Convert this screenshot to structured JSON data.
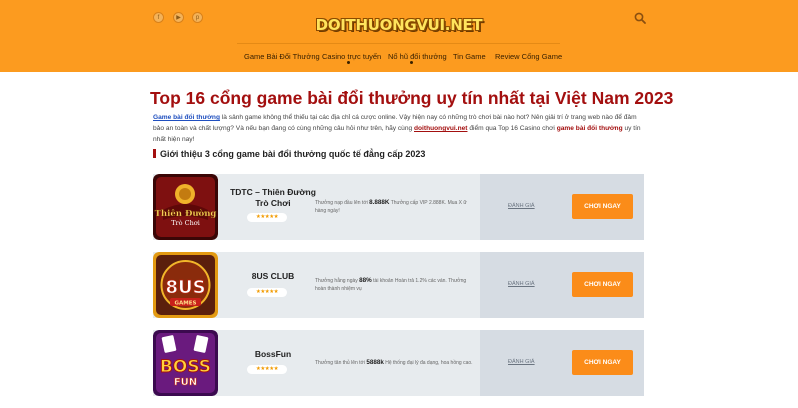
{
  "header": {
    "logo_text": "DOITHUONGVUI.NET",
    "social_icons": [
      "facebook-icon",
      "youtube-icon",
      "pinterest-icon"
    ],
    "nav": [
      {
        "label": "Game Bài Đổi Thưởng"
      },
      {
        "label": "Casino trực tuyến"
      },
      {
        "label": "Nổ hũ đổi thưởng"
      },
      {
        "label": "Tin Game"
      },
      {
        "label": "Review Cổng Game"
      }
    ],
    "colors": {
      "background": "#fc9b1f",
      "logo": "#ffe45c"
    }
  },
  "main": {
    "title": "Top 16 cổng game bài đổi thưởng uy tín nhất tại Việt Nam 2023",
    "intro": {
      "link1": "Game bài đổi thưởng",
      "text1": " là sảnh game không thể thiếu tại các địa chỉ cá cược online. Vậy hiện nay có những trò chơi bài nào hot? Nên giải trí ở trang web nào để đảm bảo an toàn và chất lượng? Và nếu bạn đang có cùng những câu hỏi như trên, hãy cùng ",
      "link2": "doithuongvui.net",
      "text2": " điểm qua Top 16 Casino chơi ",
      "bold": "game bài đổi thưởng",
      "text3": " uy tín nhất hiện nay!"
    },
    "section_heading": "Giới thiệu 3 cổng game bài đổi thưởng quốc tế đẳng cấp 2023",
    "cards": [
      {
        "logo_line1": "Thiên Đường",
        "logo_line2": "Trò Chơi",
        "name": "TDTC – Thiên Đường Trò Chơi",
        "stars": "★★★★★",
        "desc_pre": "Thưởng nạp đầu lên tới ",
        "desc_bold": "8.888K",
        "desc_post": " Thưởng cấp VIP 2.888K. Mua X ữ hàng ngày!",
        "review": "ĐÁNH GIÁ",
        "cta": "CHƠI NGAY"
      },
      {
        "logo_line1": "8US",
        "logo_line2": "GAMES",
        "name": "8US CLUB",
        "stars": "★★★★★",
        "desc_pre": "Thưởng hằng ngày ",
        "desc_bold": "88%",
        "desc_post": " tài khoản Hoàn trả 1.2% các ván. Thưởng hoàn thành nhiệm vụ",
        "review": "ĐÁNH GIÁ",
        "cta": "CHƠI NGAY"
      },
      {
        "logo_line1": "BOSS",
        "logo_line2": "FUN",
        "name": "BossFun",
        "stars": "★★★★★",
        "desc_pre": "Thưởng tân thủ lên tới ",
        "desc_bold": "5888k",
        "desc_post": " Hệ thống đại lý đa dạng, hoa hồng cao.",
        "review": "ĐÁNH GIÁ",
        "cta": "CHƠI NGAY"
      }
    ]
  }
}
